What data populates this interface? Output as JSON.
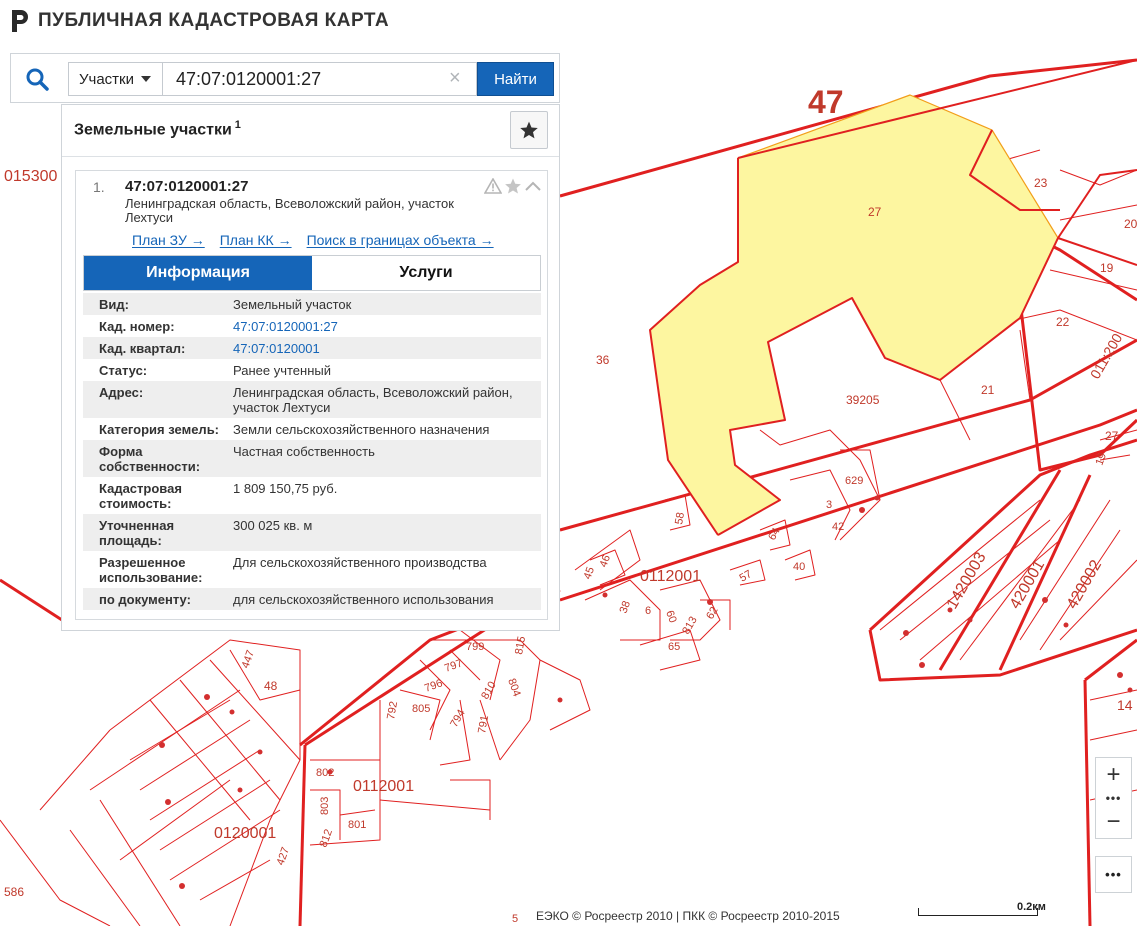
{
  "header": {
    "title": "ПУБЛИЧНАЯ КАДАСТРОВАЯ КАРТА"
  },
  "search": {
    "type_label": "Участки",
    "query": "47:07:0120001:27",
    "find_label": "Найти"
  },
  "panel": {
    "title": "Земельные участки",
    "count": "1",
    "result": {
      "index": "1.",
      "cad_number": "47:07:0120001:27",
      "address": "Ленинградская область, Всеволожский район, участок Лехтуси",
      "links": [
        "План ЗУ →",
        "План КК →",
        "Поиск в границах объекта →"
      ],
      "tabs": [
        "Информация",
        "Услуги"
      ],
      "info": [
        {
          "key": "Вид:",
          "value": "Земельный участок",
          "link": false
        },
        {
          "key": "Кад. номер:",
          "value": "47:07:0120001:27",
          "link": true
        },
        {
          "key": "Кад. квартал:",
          "value": "47:07:0120001",
          "link": true
        },
        {
          "key": "Статус:",
          "value": "Ранее учтенный",
          "link": false
        },
        {
          "key": "Адрес:",
          "value": "Ленинградская область, Всеволожский район, участок Лехтуси",
          "link": false
        },
        {
          "key": "Категория земель:",
          "value": "Земли сельскохозяйственного назначения",
          "link": false
        },
        {
          "key": "Форма собственности:",
          "value": "Частная собственность",
          "link": false
        },
        {
          "key": "Кадастровая стоимость:",
          "value": "1 809 150,75 руб.",
          "link": false
        },
        {
          "key": "Уточненная площадь:",
          "value": "300 025 кв. м",
          "link": false
        },
        {
          "key": "Разрешенное использование:",
          "value": "Для сельскохозяйственного производства",
          "link": false
        },
        {
          "key": "по документу:",
          "value": "для сельскохозяйственного использования",
          "link": false
        }
      ]
    }
  },
  "map": {
    "highlight_color": "#fdf6a0",
    "boundary_color": "#e02020",
    "label_color": "#c0392b",
    "labels": {
      "region": "47",
      "parcel_27": "27",
      "parcel_23": "23",
      "parcel_20": "20",
      "parcel_19": "19",
      "parcel_22": "22",
      "parcel_21": "21",
      "parcel_36": "36",
      "parcel_39205": "39205",
      "quarter_015300": "015300",
      "quarter_0112001_a": "0112001",
      "quarter_0112001_b": "0112001",
      "quarter_0120001": "0120001",
      "quarter_011_200": "011:200",
      "quarter_420003": "1420003",
      "quarter_420001": "420001",
      "quarter_420002": "420002",
      "parcel_48": "48",
      "parcel_586": "586",
      "parcel_58": "58",
      "parcel_64": "64",
      "parcel_57": "57",
      "parcel_40": "40",
      "parcel_42": "42",
      "parcel_629": "629",
      "parcel_3": "3",
      "parcel_65": "65",
      "parcel_60": "60",
      "parcel_62": "62",
      "parcel_813": "813",
      "parcel_815": "815",
      "parcel_799": "799",
      "parcel_797": "797",
      "parcel_796": "796",
      "parcel_804": "804",
      "parcel_810": "810",
      "parcel_805": "805",
      "parcel_792": "792",
      "parcel_794": "794",
      "parcel_791": "791",
      "parcel_802": "802",
      "parcel_803": "803",
      "parcel_812": "812",
      "parcel_801": "801",
      "parcel_447": "447",
      "parcel_427": "427",
      "parcel_46": "46",
      "parcel_45": "45",
      "parcel_38": "38",
      "parcel_6": "6",
      "parcel_14": "14",
      "parcel_27b": "27",
      "parcel_19b": "19",
      "parcel_5": "5"
    }
  },
  "zoom": {
    "in": "+",
    "out": "−",
    "dots": "•••",
    "more": "•••"
  },
  "attribution": "ЕЭКО © Росреестр 2010 | ПКК © Росреестр 2010-2015",
  "scale": "0.2км"
}
